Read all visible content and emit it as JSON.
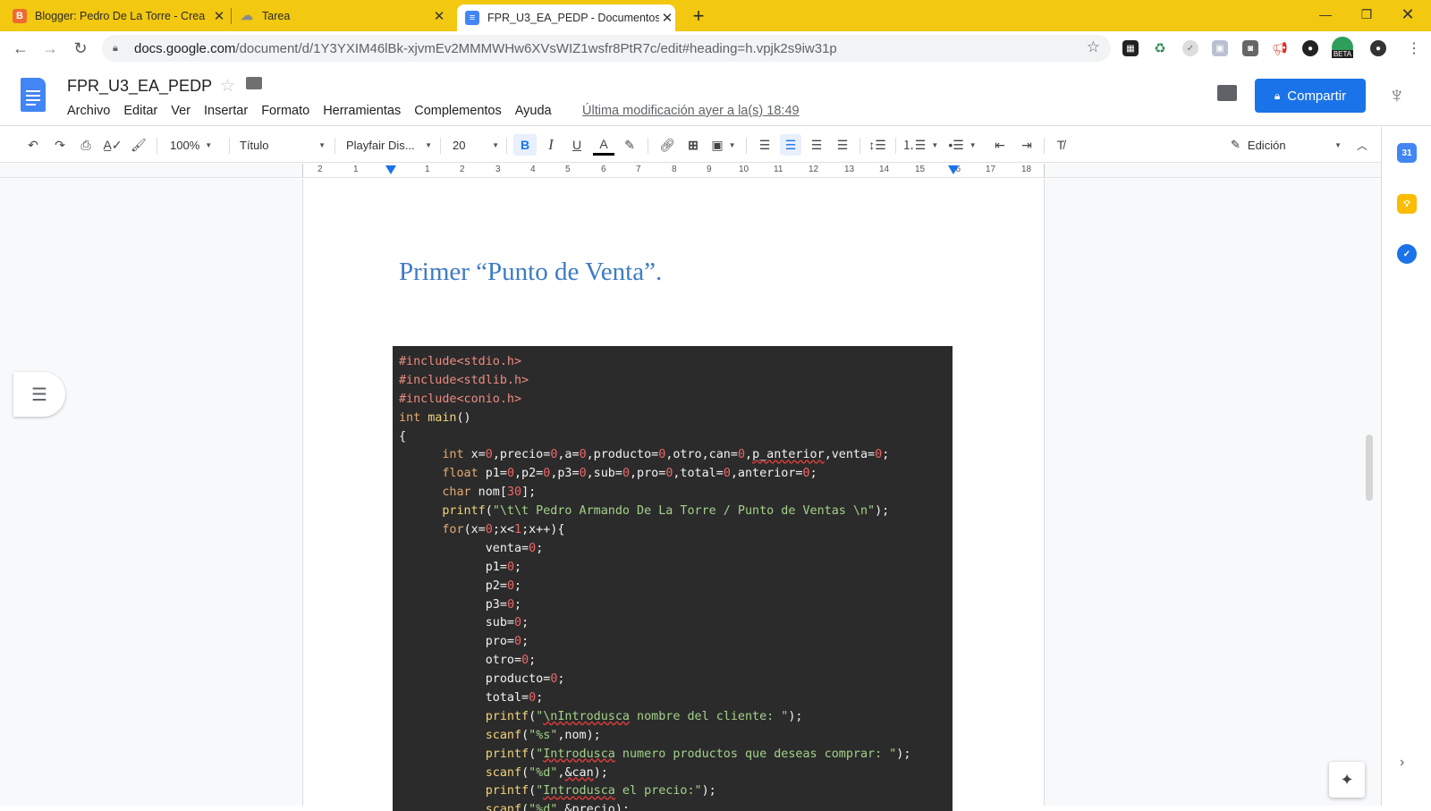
{
  "browser": {
    "tabs": [
      {
        "title": "Blogger: Pedro De La Torre - Crea",
        "icon": "blogger-icon",
        "color": "#ee6a31"
      },
      {
        "title": "Tarea",
        "icon": "cloud-icon",
        "color": "#9aa0a6"
      },
      {
        "title": "FPR_U3_EA_PEDP - Documentos",
        "icon": "docs-icon",
        "color": "#4285f4",
        "active": true
      }
    ],
    "url_host": "docs.google.com",
    "url_path": "/document/d/1Y3YXIM46lBk-xjvmEv2MMMWHw6XVsWIZ1wsfr8PtR7c/edit#heading=h.vpjk2s9iw31p",
    "ext_beta_label": "BETA"
  },
  "docs": {
    "title": "FPR_U3_EA_PEDP",
    "menu": [
      "Archivo",
      "Editar",
      "Ver",
      "Insertar",
      "Formato",
      "Herramientas",
      "Complementos",
      "Ayuda"
    ],
    "last_modified": "Última modificación ayer a la(s) 18:49",
    "share_label": "Compartir",
    "accent": "#1a73e8"
  },
  "toolbar": {
    "zoom": "100%",
    "style": "Título",
    "font": "Playfair Dis...",
    "size": "20",
    "mode": "Edición"
  },
  "ruler": {
    "ticks": [
      "2",
      "1",
      "1",
      "2",
      "3",
      "4",
      "5",
      "6",
      "7",
      "8",
      "9",
      "10",
      "11",
      "12",
      "13",
      "14",
      "15",
      "16",
      "17",
      "18"
    ]
  },
  "document": {
    "heading": "Primer “Punto de Venta”.",
    "code_lines": [
      "#include<stdio.h>",
      "#include<stdlib.h>",
      "#include<conio.h>",
      "int main()",
      "{",
      "      int x=0,precio=0,a=0,producto=0,otro,can=0,p_anterior,venta=0;",
      "      float p1=0,p2=0,p3=0,sub=0,pro=0,total=0,anterior=0;",
      "      char nom[30];",
      "      printf(\"\\t\\t Pedro Armando De La Torre / Punto de Ventas \\n\");",
      "      for(x=0;x<1;x++){",
      "            venta=0;",
      "            p1=0;",
      "            p2=0;",
      "            p3=0;",
      "            sub=0;",
      "            pro=0;",
      "            otro=0;",
      "            producto=0;",
      "            total=0;",
      "            printf(\"\\nIntrodusca nombre del cliente: \");",
      "            scanf(\"%s\",nom);",
      "            printf(\"Introdusca numero productos que deseas comprar: \");",
      "            scanf(\"%d\",&can);",
      "            printf(\"Introdusca el precio:\");",
      "            scanf(\"%d\",&precio);"
    ]
  },
  "side_panel": {
    "calendar_label": "31"
  }
}
